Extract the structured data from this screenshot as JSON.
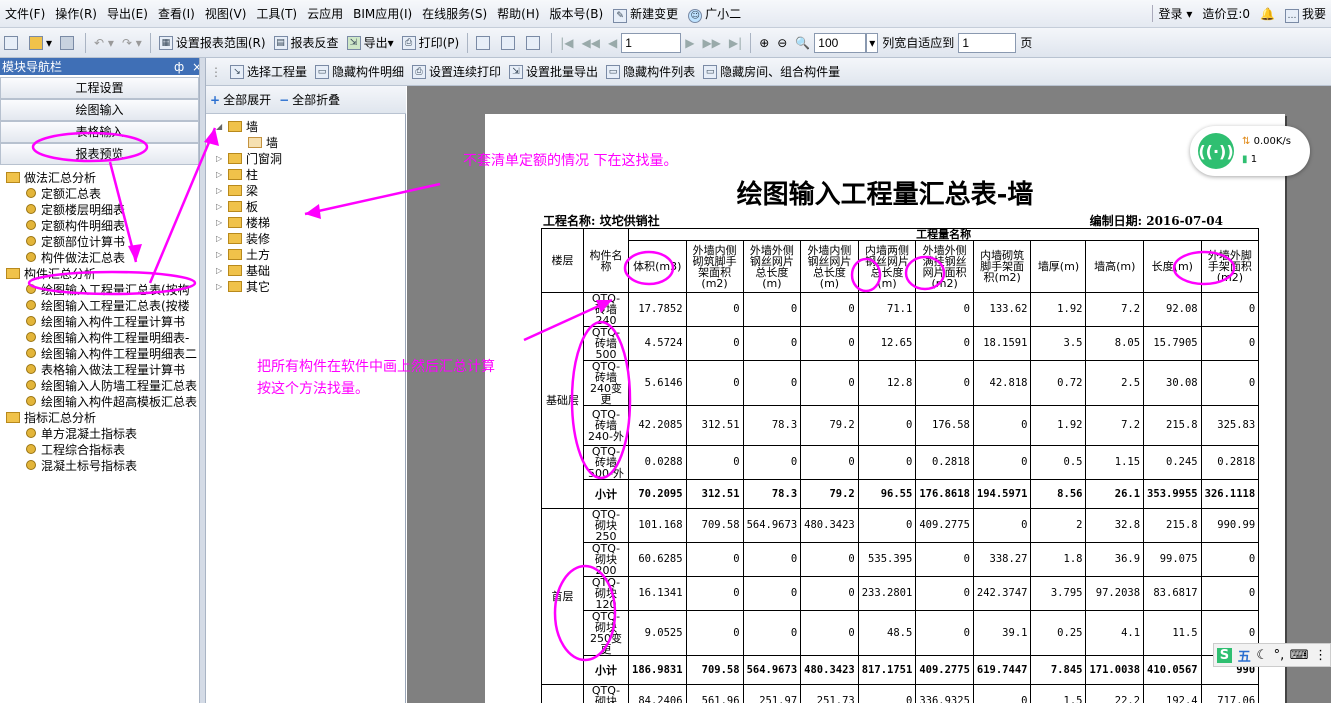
{
  "menubar": {
    "items": [
      "文件(F)",
      "操作(R)",
      "导出(E)",
      "查看(I)",
      "视图(V)",
      "工具(T)",
      "云应用",
      "BIM应用(I)",
      "在线服务(S)",
      "帮助(H)",
      "版本号(B)"
    ],
    "new_change": "新建变更",
    "assistant": "广小二",
    "login": "登录",
    "cost_beans": "造价豆:0",
    "suggest": "我要"
  },
  "toolbar1": {
    "set_range": "设置报表范围(R)",
    "review": "报表反查",
    "export": "导出",
    "print": "打印(P)",
    "page": "1",
    "zoom": "100",
    "fit_label": "列宽自适应到",
    "fit_value": "1",
    "page_unit": "页"
  },
  "nav": {
    "title": "模块导航栏",
    "pin": "ф",
    "close": "×",
    "buttons": [
      "工程设置",
      "绘图输入",
      "表格输入",
      "报表预览"
    ]
  },
  "tree": [
    {
      "label": "做法汇总分析",
      "level": 0,
      "type": "folder"
    },
    {
      "label": "定额汇总表",
      "level": 1,
      "type": "item"
    },
    {
      "label": "定额楼层明细表",
      "level": 1,
      "type": "item"
    },
    {
      "label": "定额构件明细表",
      "level": 1,
      "type": "item"
    },
    {
      "label": "定额部位计算书",
      "level": 1,
      "type": "item"
    },
    {
      "label": "构件做法汇总表",
      "level": 1,
      "type": "item"
    },
    {
      "label": "构件汇总分析",
      "level": 0,
      "type": "folder"
    },
    {
      "label": "绘图输入工程量汇总表(按构",
      "level": 1,
      "type": "item"
    },
    {
      "label": "绘图输入工程量汇总表(按楼",
      "level": 1,
      "type": "item"
    },
    {
      "label": "绘图输入构件工程量计算书",
      "level": 1,
      "type": "item"
    },
    {
      "label": "绘图输入构件工程量明细表-",
      "level": 1,
      "type": "item"
    },
    {
      "label": "绘图输入构件工程量明细表二",
      "level": 1,
      "type": "item"
    },
    {
      "label": "表格输入做法工程量计算书",
      "level": 1,
      "type": "item"
    },
    {
      "label": "绘图输入人防墙工程量汇总表",
      "level": 1,
      "type": "item"
    },
    {
      "label": "绘图输入构件超高模板汇总表",
      "level": 1,
      "type": "item"
    },
    {
      "label": "指标汇总分析",
      "level": 0,
      "type": "folder"
    },
    {
      "label": "单方混凝土指标表",
      "level": 1,
      "type": "item"
    },
    {
      "label": "工程综合指标表",
      "level": 1,
      "type": "item"
    },
    {
      "label": "混凝土标号指标表",
      "level": 1,
      "type": "item"
    }
  ],
  "toolbar2": {
    "items": [
      "选择工程量",
      "隐藏构件明细",
      "设置连续打印",
      "设置批量导出",
      "隐藏构件列表",
      "隐藏房间、组合构件量"
    ]
  },
  "mid": {
    "expand": "全部展开",
    "collapse": "全部折叠",
    "tree": [
      {
        "label": "墙",
        "level": 0
      },
      {
        "label": "墙",
        "level": 1
      },
      {
        "label": "门窗洞",
        "level": 0
      },
      {
        "label": "柱",
        "level": 0
      },
      {
        "label": "梁",
        "level": 0
      },
      {
        "label": "板",
        "level": 0
      },
      {
        "label": "楼梯",
        "level": 0
      },
      {
        "label": "装修",
        "level": 0
      },
      {
        "label": "土方",
        "level": 0
      },
      {
        "label": "基础",
        "level": 0
      },
      {
        "label": "其它",
        "level": 0
      }
    ]
  },
  "report": {
    "title": "绘图输入工程量汇总表-墙",
    "project": "工程名称: 坟坨供销社",
    "date": "编制日期: 2016-07-04",
    "col_floor": "楼层",
    "col_name": "构件名称",
    "group_header": "工程量名称",
    "headers": [
      "体积(m3)",
      "外墙内侧砌筑脚手架面积(m2)",
      "外墙外侧钢丝网片总长度(m)",
      "外墙内侧钢丝网片总长度(m)",
      "内墙两侧钢丝网片总长度(m)",
      "外墙外侧满挂钢丝网片面积(m2)",
      "内墙砌筑脚手架面积(m2)",
      "墙厚(m)",
      "墙高(m)",
      "长度(m)",
      "外墙外脚手架面积(m2)"
    ],
    "groups": [
      {
        "floor": "基础层",
        "rows": [
          {
            "name": "QTQ-砖墙240",
            "v": [
              "17.7852",
              "0",
              "0",
              "0",
              "71.1",
              "0",
              "133.62",
              "1.92",
              "7.2",
              "92.08",
              "0"
            ]
          },
          {
            "name": "QTQ-砖墙500",
            "v": [
              "4.5724",
              "0",
              "0",
              "0",
              "12.65",
              "0",
              "18.1591",
              "3.5",
              "8.05",
              "15.7905",
              "0"
            ]
          },
          {
            "name": "QTQ-砖墙240变更",
            "v": [
              "5.6146",
              "0",
              "0",
              "0",
              "12.8",
              "0",
              "42.818",
              "0.72",
              "2.5",
              "30.08",
              "0"
            ]
          },
          {
            "name": "QTQ-砖墙240-外",
            "v": [
              "42.2085",
              "312.51",
              "78.3",
              "79.2",
              "0",
              "176.58",
              "0",
              "1.92",
              "7.2",
              "215.8",
              "325.83"
            ]
          },
          {
            "name": "QTQ-砖墙500-外",
            "v": [
              "0.0288",
              "0",
              "0",
              "0",
              "0",
              "0.2818",
              "0",
              "0.5",
              "1.15",
              "0.245",
              "0.2818"
            ]
          }
        ],
        "subtotal_label": "小计",
        "subtotal": [
          "70.2095",
          "312.51",
          "78.3",
          "79.2",
          "96.55",
          "176.8618",
          "194.5971",
          "8.56",
          "26.1",
          "353.9955",
          "326.1118"
        ]
      },
      {
        "floor": "首层",
        "rows": [
          {
            "name": "QTQ-砌块250",
            "v": [
              "101.168",
              "709.58",
              "564.9673",
              "480.3423",
              "0",
              "409.2775",
              "0",
              "2",
              "32.8",
              "215.8",
              "990.99"
            ]
          },
          {
            "name": "QTQ-砌块200",
            "v": [
              "60.6285",
              "0",
              "0",
              "0",
              "535.395",
              "0",
              "338.27",
              "1.8",
              "36.9",
              "99.075",
              "0"
            ]
          },
          {
            "name": "QTQ-砌块120",
            "v": [
              "16.1341",
              "0",
              "0",
              "0",
              "233.2801",
              "0",
              "242.3747",
              "3.795",
              "97.2038",
              "83.6817",
              "0"
            ]
          },
          {
            "name": "QTQ-砌块250变更",
            "v": [
              "9.0525",
              "0",
              "0",
              "0",
              "48.5",
              "0",
              "39.1",
              "0.25",
              "4.1",
              "11.5",
              "0"
            ]
          }
        ],
        "subtotal_label": "小计",
        "subtotal": [
          "186.9831",
          "709.58",
          "564.9673",
          "480.3423",
          "817.1751",
          "409.2775",
          "619.7447",
          "7.845",
          "171.0038",
          "410.0567",
          "990"
        ]
      },
      {
        "floor": "",
        "rows": [
          {
            "name": "QTQ-砌块250",
            "v": [
              "84.2406",
              "561.96",
              "251.97",
              "251.73",
              "0",
              "336.9325",
              "0",
              "1.5",
              "22.2",
              "192.4",
              "717.06"
            ]
          }
        ]
      }
    ]
  },
  "annotations": {
    "note1": "不套清单定额的情况 下在这找量。",
    "note2": "把所有构件在软件中画上然后汇总计算",
    "note3": "按这个方法找量。"
  },
  "network": {
    "speed": "0.00K/s",
    "count": "1"
  },
  "ime": {
    "s": "S",
    "label": "五"
  },
  "colors": {
    "annotation": "#ff00ff",
    "nav_header": "#3f6fb6",
    "preview_bg": "#808080",
    "wifi": "#2fbf71"
  }
}
